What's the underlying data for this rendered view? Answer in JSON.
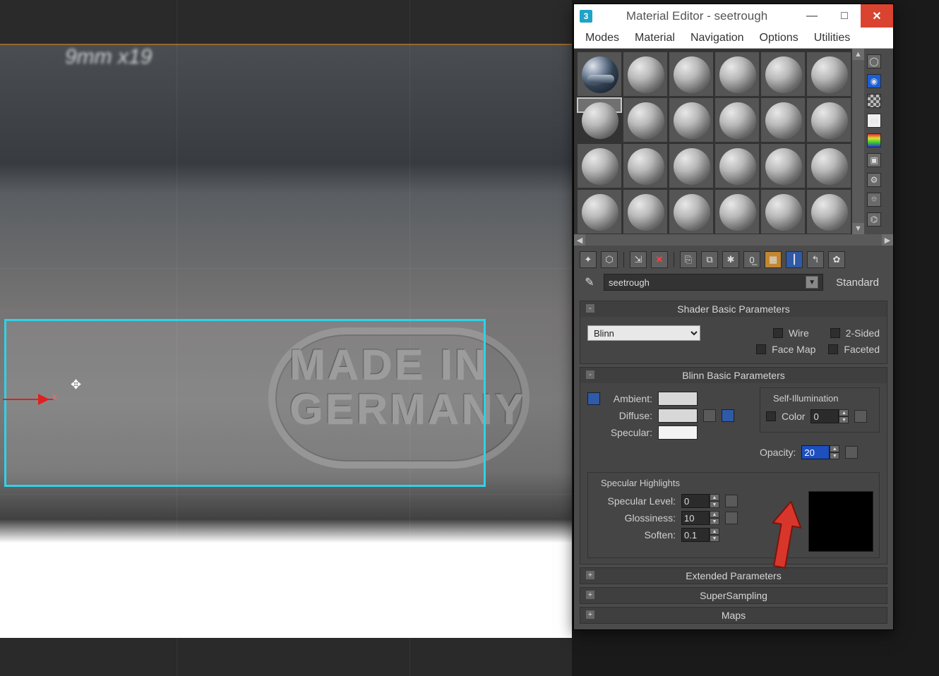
{
  "viewport": {
    "top_text": "9mm x19",
    "stamp_line1": "MADE IN",
    "stamp_line2": "GERMANY",
    "gizmo_axis": "x"
  },
  "window": {
    "title": "Material Editor - seetrough",
    "menus": [
      "Modes",
      "Material",
      "Navigation",
      "Options",
      "Utilities"
    ],
    "material_name": "seetrough",
    "type_button": "Standard"
  },
  "shader_basic": {
    "header": "Shader Basic Parameters",
    "shader": "Blinn",
    "wire": "Wire",
    "two_sided": "2-Sided",
    "face_map": "Face Map",
    "faceted": "Faceted"
  },
  "blinn_basic": {
    "header": "Blinn Basic Parameters",
    "ambient": "Ambient:",
    "diffuse": "Diffuse:",
    "specular": "Specular:",
    "self_illum_group": "Self-Illumination",
    "color_label": "Color",
    "color_value": "0",
    "opacity_label": "Opacity:",
    "opacity_value": "20",
    "spec_highlights": "Specular Highlights",
    "spec_level_label": "Specular Level:",
    "spec_level_value": "0",
    "gloss_label": "Glossiness:",
    "gloss_value": "10",
    "soften_label": "Soften:",
    "soften_value": "0.1"
  },
  "rollouts_collapsed": {
    "extended": "Extended Parameters",
    "supersampling": "SuperSampling",
    "maps": "Maps"
  }
}
